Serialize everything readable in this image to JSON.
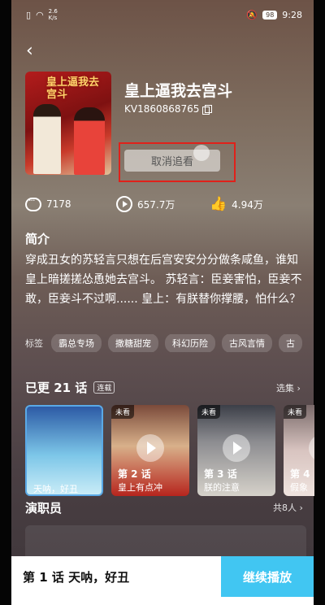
{
  "status_bar": {
    "speed_value": "2.6",
    "speed_unit": "K/s",
    "battery": "98",
    "time": "9:28"
  },
  "drama": {
    "title": "皇上逼我去宫斗",
    "code": "KV1860868765",
    "poster_title": "皇上逼我去宫斗",
    "follow_button": "取消追看"
  },
  "stats": {
    "comments": "7178",
    "plays": "657.7万",
    "likes": "4.94万"
  },
  "intro": {
    "heading": "简介",
    "text": "穿成丑女的苏轻言只想在后宫安安分分做条咸鱼，谁知皇上暗搓搓怂恿她去宫斗。 苏轻言：臣妾害怕，臣妾不敢，臣妾斗不过啊...... 皇上：有朕替你撑腰，怕什么？"
  },
  "tags": {
    "label": "标签",
    "items": [
      "霸总专场",
      "撒糖甜宠",
      "科幻历险",
      "古风言情",
      "古"
    ]
  },
  "episodes": {
    "heading": "已更 21 话",
    "badge": "连载",
    "select_label": "选集 ›",
    "items": [
      {
        "num": "",
        "name": "天呐，好丑",
        "unwatched": ""
      },
      {
        "num": "第 2 话",
        "name": "皇上有点冲",
        "unwatched": "未看"
      },
      {
        "num": "第 3 话",
        "name": "朕的注意",
        "unwatched": "未看"
      },
      {
        "num": "第 4",
        "name": "假象",
        "unwatched": "未看"
      }
    ]
  },
  "cast": {
    "heading": "演职员",
    "count": "共8人 ›"
  },
  "bottom_bar": {
    "now_playing": "第 1 话 天呐，好丑",
    "continue_label": "继续播放"
  },
  "colors": {
    "highlight_box": "#e0211a",
    "continue_button": "#41c6f2"
  }
}
